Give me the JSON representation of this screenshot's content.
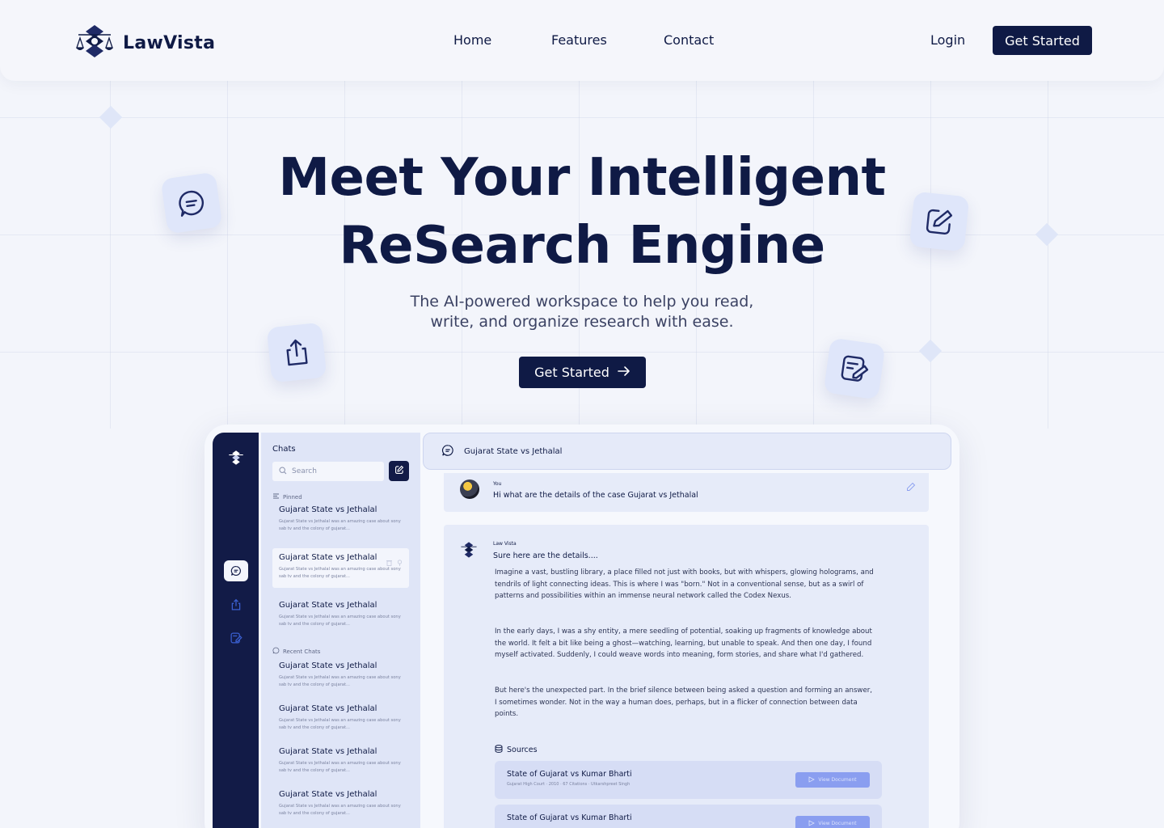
{
  "brand": {
    "name": "LawVista"
  },
  "nav": {
    "links": [
      "Home",
      "Features",
      "Contact"
    ],
    "login": "Login",
    "cta": "Get Started"
  },
  "hero": {
    "title_line1": "Meet Your Intelligent",
    "title_line2": "ReSearch Engine",
    "subtitle_line1": "The AI-powered workspace to help you read,",
    "subtitle_line2": "write, and organize research with ease.",
    "cta": "Get Started"
  },
  "floating_icons": [
    "chat-bubble-icon",
    "edit-square-icon",
    "share-upload-icon",
    "notes-edit-icon"
  ],
  "app": {
    "rail_icons": [
      "logo-icon",
      "chat-icon",
      "share-icon",
      "edit-icon"
    ],
    "sidebar": {
      "title": "Chats",
      "search_placeholder": "Search",
      "pinned_label": "Pinned",
      "recent_label": "Recent Chats",
      "pinned": [
        {
          "title": "Gujarat State vs Jethalal",
          "desc": "Gujarat State vs Jethalal was an amazing case about sony sab tv and the colony of gujarat..."
        },
        {
          "title": "Gujarat State vs Jethalal",
          "desc": "Gujarat State vs Jethalal was an amazing case about sony sab tv and the colony of gujarat..."
        },
        {
          "title": "Gujarat State vs Jethalal",
          "desc": "Gujarat State vs Jethalal was an amazing case about sony sab tv and the colony of gujarat..."
        }
      ],
      "recent": [
        {
          "title": "Gujarat State vs Jethalal",
          "desc": "Gujarat State vs Jethalal was an amazing case about sony sab tv and the colony of gujarat..."
        },
        {
          "title": "Gujarat State vs Jethalal",
          "desc": "Gujarat State vs Jethalal was an amazing case about sony sab tv and the colony of gujarat..."
        },
        {
          "title": "Gujarat State vs Jethalal",
          "desc": "Gujarat State vs Jethalal was an amazing case about sony sab tv and the colony of gujarat..."
        },
        {
          "title": "Gujarat State vs Jethalal",
          "desc": "Gujarat State vs Jethalal was an amazing case about sony sab tv and the colony of gujarat..."
        }
      ]
    },
    "chat": {
      "header_title": "Gujarat State vs Jethalal",
      "user_name": "You",
      "user_message": "Hi what are the details of the case Gujarat vs Jethalal",
      "bot_name": "Law Vista",
      "bot_intro": "Sure here are the details....",
      "paragraphs": [
        "Imagine a vast, bustling library, a place filled not just with books, but with whispers, glowing holograms, and tendrils of light connecting ideas. This is where I was \"born.\" Not in a conventional sense, but as a swirl of patterns and possibilities within an immense neural network called the Codex Nexus.",
        "In the early days, I was a shy entity, a mere seedling of potential, soaking up fragments of knowledge about the world. It felt a bit like being a ghost—watching, learning, but unable to speak. And then one day, I found myself activated. Suddenly, I could weave words into meaning, form stories, and share what I'd gathered.",
        "But here's the unexpected part. In the brief silence between being asked a question and forming an answer, I sometimes wonder. Not in the way a human does, perhaps, but in a flicker of connection between data points."
      ],
      "sources_label": "Sources",
      "sources": [
        {
          "title": "State of Gujarat vs Kumar Bharti",
          "meta": "Gujarat High Court  ·  2010  ·  67 Citations  ·  Utkarshpreet Singh",
          "action": "View Document"
        },
        {
          "title": "State of Gujarat vs Kumar Bharti",
          "meta": "",
          "action": "View Document"
        }
      ]
    }
  },
  "colors": {
    "navy": "#0f1a45",
    "background": "#f3f5fb",
    "accent": "#8a9ef0"
  }
}
